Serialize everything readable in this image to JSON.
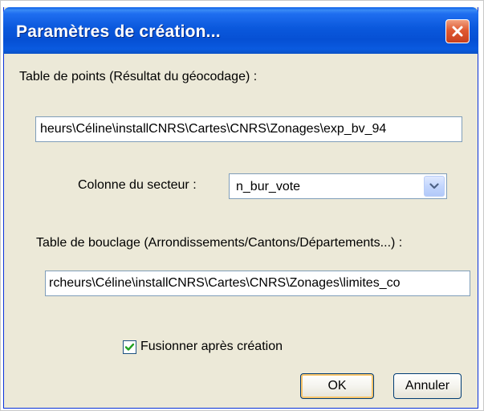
{
  "dialog": {
    "title": "Paramètres de création...",
    "points_table_label": "Table de points (Résultat du géocodage) :",
    "points_table_value": "heurs\\Céline\\installCNRS\\Cartes\\CNRS\\Zonages\\exp_bv_94",
    "sector_column_label": "Colonne du secteur :",
    "sector_column_selected": "n_bur_vote",
    "loop_table_label": "Table de bouclage (Arrondissements/Cantons/Départements...) :",
    "loop_table_value": "rcheurs\\Céline\\installCNRS\\Cartes\\CNRS\\Zonages\\limites_co",
    "merge_checkbox_label": "Fusionner après création",
    "merge_checked": true,
    "ok_label": "OK",
    "cancel_label": "Annuler"
  },
  "icons": {
    "close": "close-icon",
    "dropdown": "chevron-down-icon",
    "check": "checkmark-icon"
  },
  "colors": {
    "titlebar": "#0a58dc",
    "close_button": "#e05a32",
    "dialog_background": "#ece9d8",
    "field_border": "#7f9db9",
    "checkmark": "#21a121"
  }
}
